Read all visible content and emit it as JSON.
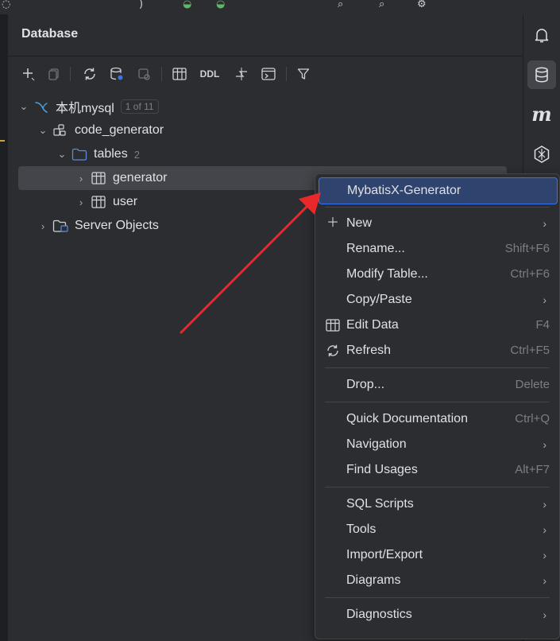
{
  "panel": {
    "title": "Database"
  },
  "toolbar": {
    "ddl_label": "DDL",
    "buttons": [
      "add-icon",
      "copy-icon",
      "refresh-icon",
      "datasource-properties-icon",
      "jump-to-console-icon",
      "table-icon",
      "ddl",
      "compare-icon",
      "console-icon",
      "filter-icon"
    ]
  },
  "tree": {
    "datasource": {
      "name": "本机mysql",
      "badge": "1 of 11"
    },
    "schema": {
      "name": "code_generator"
    },
    "tables_folder": {
      "name": "tables",
      "count": "2"
    },
    "tables": [
      {
        "name": "generator"
      },
      {
        "name": "user"
      }
    ],
    "server_objects": {
      "name": "Server Objects"
    }
  },
  "context_menu": {
    "items": [
      {
        "label": "MybatisX-Generator",
        "shortcut": "",
        "submenu": false,
        "highlighted": true
      },
      {
        "label": "New",
        "shortcut": "",
        "submenu": true,
        "icon": "plus-icon"
      },
      {
        "label": "Rename...",
        "shortcut": "Shift+F6",
        "submenu": false
      },
      {
        "label": "Modify Table...",
        "shortcut": "Ctrl+F6",
        "submenu": false
      },
      {
        "label": "Copy/Paste",
        "shortcut": "",
        "submenu": true
      },
      {
        "label": "Edit Data",
        "shortcut": "F4",
        "submenu": false,
        "icon": "table-icon"
      },
      {
        "label": "Refresh",
        "shortcut": "Ctrl+F5",
        "submenu": false,
        "icon": "refresh-icon"
      },
      {
        "label": "Drop...",
        "shortcut": "Delete",
        "submenu": false
      },
      {
        "label": "Quick Documentation",
        "shortcut": "Ctrl+Q",
        "submenu": false
      },
      {
        "label": "Navigation",
        "shortcut": "",
        "submenu": true
      },
      {
        "label": "Find Usages",
        "shortcut": "Alt+F7",
        "submenu": false
      },
      {
        "label": "SQL Scripts",
        "shortcut": "",
        "submenu": true
      },
      {
        "label": "Tools",
        "shortcut": "",
        "submenu": true
      },
      {
        "label": "Import/Export",
        "shortcut": "",
        "submenu": true
      },
      {
        "label": "Diagrams",
        "shortcut": "",
        "submenu": true
      },
      {
        "label": "Diagnostics",
        "shortcut": "",
        "submenu": true
      }
    ]
  },
  "right_sidebar": {
    "buttons": [
      "notifications-icon",
      "database-icon",
      "mybatis-icon",
      "ai-assistant-icon"
    ],
    "mybatis_glyph": "m"
  },
  "colors": {
    "panel_bg": "#2b2d30",
    "editor_bg": "#1e1f22",
    "highlight": "#2e436e",
    "highlight_border": "#3574f0",
    "annotation_arrow": "#e8282b",
    "mysql_icon": "#4a9fd6",
    "folder_icon": "#5b8bd6"
  }
}
